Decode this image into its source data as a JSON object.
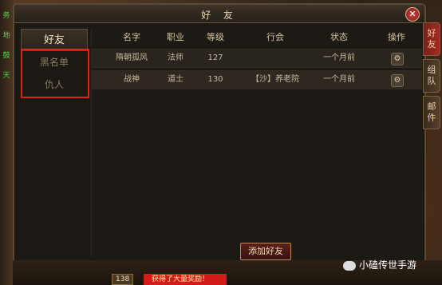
{
  "window": {
    "title": "好 友",
    "close": "✕"
  },
  "tabs": [
    {
      "label": "好友"
    },
    {
      "label": "黑名单"
    },
    {
      "label": "仇人"
    }
  ],
  "columns": [
    "名字",
    "职业",
    "等级",
    "行会",
    "状态",
    "操作"
  ],
  "rows": [
    {
      "name": "隋朝孤风",
      "class": "法师",
      "level": "127",
      "guild": "",
      "status": "一个月前"
    },
    {
      "name": "战神",
      "class": "道士",
      "level": "130",
      "guild": "【沙】养老院",
      "status": "一个月前"
    }
  ],
  "add_button": "添加好友",
  "side_tabs": [
    {
      "label": "好友"
    },
    {
      "label": "组队"
    },
    {
      "label": "邮件"
    }
  ],
  "left_strip": [
    "务",
    "地",
    "鼓",
    "天"
  ],
  "bottom": {
    "level_badge": "138",
    "toast": "获得了大量奖励！"
  },
  "watermark": "小磕传世手游",
  "icons": {
    "close": "close-icon",
    "gear": "gear-icon"
  },
  "colors": {
    "accent_red": "#e0221b",
    "title_text": "#e8d7b0"
  }
}
